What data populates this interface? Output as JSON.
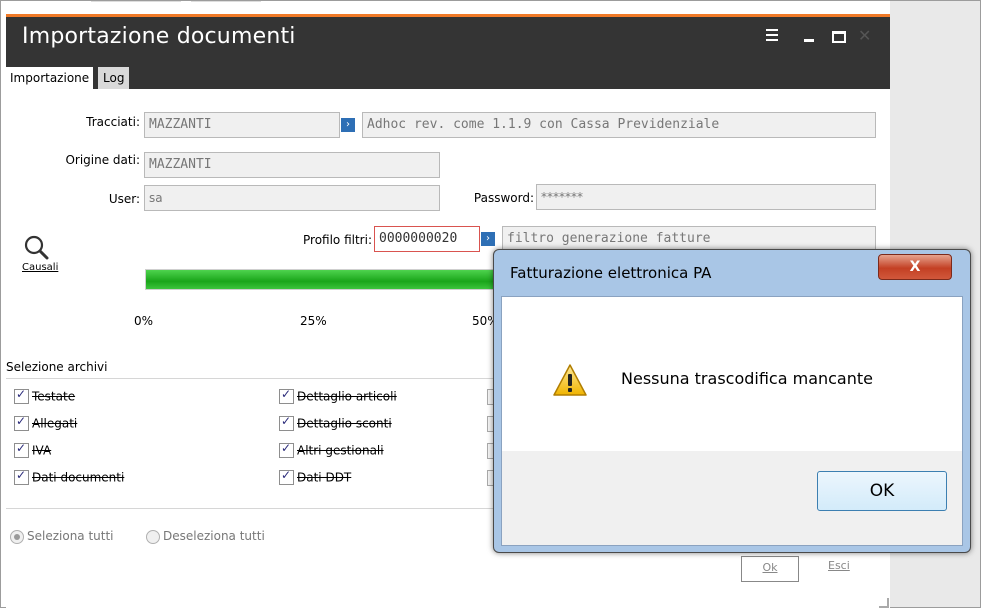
{
  "window": {
    "title": "Importazione documenti",
    "tabs": [
      {
        "label": "Importazione"
      },
      {
        "label": "Log"
      }
    ]
  },
  "form": {
    "tracciati_label": "Tracciati:",
    "tracciati_value": "MAZZANTI",
    "tracciati_desc": "Adhoc rev. come 1.1.9 con Cassa Previdenziale",
    "origine_label": "Origine dati:",
    "origine_value": "MAZZANTI",
    "user_label": "User:",
    "user_value": "sa",
    "password_label": "Password:",
    "password_value": "*******",
    "profilo_label": "Profilo filtri:",
    "profilo_value": "0000000020",
    "profilo_desc": "filtro generazione fatture",
    "causali_label": "Causali"
  },
  "progress": {
    "value": 0.86,
    "ticks": [
      "0%",
      "25%",
      "50%"
    ]
  },
  "archivi": {
    "title": "Selezione archivi",
    "col1": [
      "Testate",
      "Allegati",
      "IVA",
      "Dati documenti"
    ],
    "col2": [
      "Dettaglio articoli",
      "Dettaglio sconti",
      "Altri gestionali",
      "Dati DDT"
    ]
  },
  "selection": {
    "select_all": "Seleziona tutti",
    "deselect_all": "Deseleziona tutti"
  },
  "buttons": {
    "ok": "Ok",
    "esci": "Esci"
  },
  "dialog": {
    "title": "Fatturazione elettronica PA",
    "message": "Nessuna trascodifica mancante",
    "ok": "OK",
    "close_glyph": "X"
  },
  "colors": {
    "titlebar": "#343434",
    "accent_orange": "#f07a28",
    "progress_green": "#1aa51a",
    "dialog_frame": "#a9c6e6"
  }
}
